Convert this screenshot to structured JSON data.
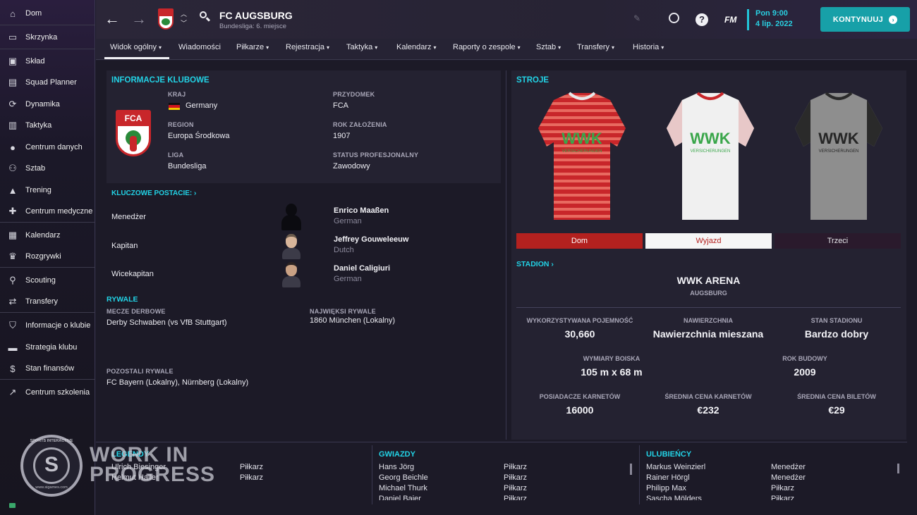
{
  "sidebar": {
    "items": [
      {
        "label": "Dom",
        "icon": "home-icon"
      },
      {
        "label": "Skrzynka",
        "icon": "inbox-icon"
      },
      {
        "label": "Skład",
        "icon": "squad-shirt-icon"
      },
      {
        "label": "Squad Planner",
        "icon": "clipboard-icon"
      },
      {
        "label": "Dynamika",
        "icon": "dynamics-icon"
      },
      {
        "label": "Taktyka",
        "icon": "tactics-icon"
      },
      {
        "label": "Centrum danych",
        "icon": "data-hub-icon"
      },
      {
        "label": "Sztab",
        "icon": "staff-icon"
      },
      {
        "label": "Trening",
        "icon": "training-cone-icon"
      },
      {
        "label": "Centrum medyczne",
        "icon": "medical-icon"
      },
      {
        "label": "Kalendarz",
        "icon": "calendar-icon"
      },
      {
        "label": "Rozgrywki",
        "icon": "trophy-icon"
      },
      {
        "label": "Scouting",
        "icon": "search-icon"
      },
      {
        "label": "Transfery",
        "icon": "transfer-icon"
      },
      {
        "label": "Informacje o klubie",
        "icon": "shield-icon"
      },
      {
        "label": "Strategia klubu",
        "icon": "briefcase-icon"
      },
      {
        "label": "Stan finansów",
        "icon": "finances-icon"
      },
      {
        "label": "Centrum szkolenia",
        "icon": "development-icon"
      }
    ]
  },
  "header": {
    "club_name": "FC AUGSBURG",
    "subtitle": "Bundesliga: 6. miejsce",
    "fm_label": "FM",
    "date_line1": "Pon 9:00",
    "date_line2": "4 lip. 2022",
    "continue_label": "KONTYNUUJ"
  },
  "nav": {
    "tabs": [
      "Widok ogólny",
      "Wiadomości",
      "Piłkarze",
      "Rejestracja",
      "Taktyka",
      "Kalendarz",
      "Raporty o zespole",
      "Sztab",
      "Transfery",
      "Historia"
    ]
  },
  "club_info": {
    "heading": "INFORMACJE KLUBOWE",
    "badge_text": "FCA",
    "country_label": "KRAJ",
    "country": "Germany",
    "region_label": "REGION",
    "region": "Europa Środkowa",
    "league_label": "LIGA",
    "league": "Bundesliga",
    "nickname_label": "PRZYDOMEK",
    "nickname": "FCA",
    "founded_label": "ROK ZAŁOŻENIA",
    "founded": "1907",
    "status_label": "STATUS PROFESJONALNY",
    "status": "Zawodowy"
  },
  "key_people": {
    "heading": "KLUCZOWE POSTACIE:",
    "rows": [
      {
        "role": "Menedżer",
        "name": "Enrico Maaßen",
        "nationality": "German"
      },
      {
        "role": "Kapitan",
        "name": "Jeffrey Gouweleeuw",
        "nationality": "Dutch"
      },
      {
        "role": "Wicekapitan",
        "name": "Daniel Caligiuri",
        "nationality": "German"
      }
    ]
  },
  "rivals": {
    "heading": "RYWALE",
    "derby_label": "MECZE DERBOWE",
    "derby": "Derby Schwaben (vs VfB Stuttgart)",
    "biggest_label": "NAJWIĘKSI RYWALE",
    "biggest": "1860 München (Lokalny)",
    "other_label": "POZOSTALI RYWALE",
    "other": "FC Bayern (Lokalny), Nürnberg (Lokalny)"
  },
  "kits": {
    "heading": "STROJE",
    "sponsor": "WWK",
    "sponsor_sub": "VERSICHERUNGEN",
    "buttons": [
      "Dom",
      "Wyjazd",
      "Trzeci"
    ],
    "home_color": "#c8262a",
    "away_color": "#f2f2f2",
    "third_color": "#8e8e8e"
  },
  "stadium": {
    "heading": "STADION",
    "name": "WWK ARENA",
    "city": "AUGSBURG",
    "capacity_label": "WYKORZYSTYWANA POJEMNOŚĆ",
    "capacity": "30,660",
    "surface_label": "NAWIERZCHNIA",
    "surface": "Nawierzchnia mieszana",
    "condition_label": "STAN STADIONU",
    "condition": "Bardzo dobry",
    "pitch_label": "WYMIARY BOISKA",
    "pitch": "105 m x 68 m",
    "built_label": "ROK BUDOWY",
    "built": "2009",
    "season_ticket_label": "POSIADACZE KARNETÓW",
    "season_ticket": "16000",
    "avg_season_label": "ŚREDNIA CENA KARNETÓW",
    "avg_season": "€232",
    "avg_ticket_label": "ŚREDNIA CENA BILETÓW",
    "avg_ticket": "€29"
  },
  "legends": {
    "heading": "LEGENDY",
    "rows": [
      {
        "name": "Ulrich Biesinger",
        "role": "Piłkarz"
      },
      {
        "name": "Helmut Haller",
        "role": "Piłkarz"
      }
    ]
  },
  "stars": {
    "heading": "GWIAZDY",
    "rows": [
      {
        "name": "Hans Jörg",
        "role": "Piłkarz"
      },
      {
        "name": "Georg Beichle",
        "role": "Piłkarz"
      },
      {
        "name": "Michael Thurk",
        "role": "Piłkarz"
      },
      {
        "name": "Daniel Baier",
        "role": "Piłkarz"
      }
    ]
  },
  "favourites": {
    "heading": "ULUBIEŃCY",
    "rows": [
      {
        "name": "Markus Weinzierl",
        "role": "Menedżer"
      },
      {
        "name": "Rainer Hörgl",
        "role": "Menedżer"
      },
      {
        "name": "Philipp Max",
        "role": "Piłkarz"
      },
      {
        "name": "Sascha Mölders",
        "role": "Piłkarz"
      }
    ]
  },
  "watermark": {
    "line1": "WORK IN",
    "line2": "PROGRESS",
    "logo_text": "SPORTS INTERACTIVE",
    "logo_url": "www.sigames.com"
  }
}
